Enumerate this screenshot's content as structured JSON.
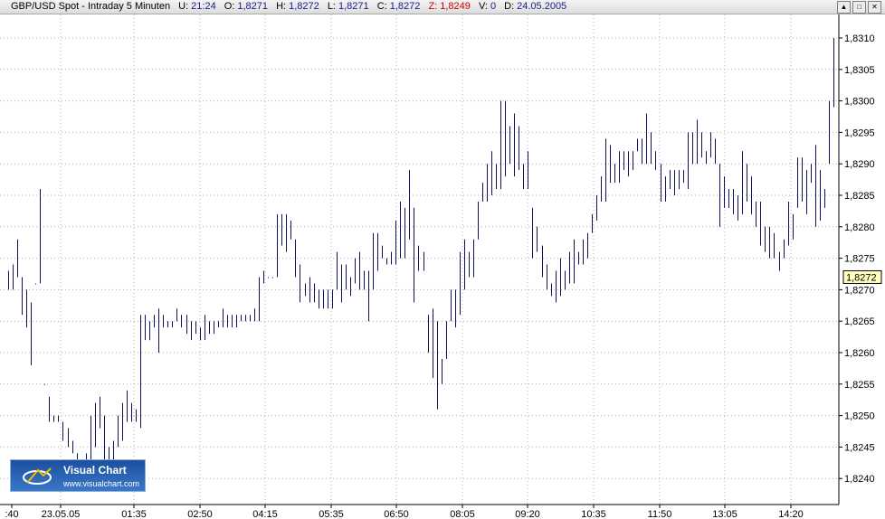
{
  "header": {
    "symbol": "GBP/USD Spot - Intraday 5 Minuten",
    "u_label": "U:",
    "u_value": "21:24",
    "o_label": "O:",
    "o_value": "1,8271",
    "h_label": "H:",
    "h_value": "1,8272",
    "l_label": "L:",
    "l_value": "1,8271",
    "c_label": "C:",
    "c_value": "1,8272",
    "z_label": "Z:",
    "z_value": "1,8249",
    "v_label": "V:",
    "v_value": "0",
    "d_label": "D:",
    "d_value": "24.05.2005"
  },
  "window_buttons": [
    "▲",
    "□",
    "✕"
  ],
  "logo": {
    "name": "Visual Chart",
    "url": "www.visualchart.com"
  },
  "colors": {
    "bars": "#101058",
    "grid": "#b0b0b0",
    "current_marker": "#ffffc0",
    "z_value": "#d00000"
  },
  "chart_data": {
    "type": "ohlc",
    "title": "GBP/USD Spot - Intraday 5 Minuten",
    "ylim": [
      1.82375,
      1.83125
    ],
    "yticks": [
      "1,8240",
      "1,8245",
      "1,8250",
      "1,8255",
      "1,8260",
      "1,8265",
      "1,8270",
      "1,8275",
      "1,8280",
      "1,8285",
      "1,8290",
      "1,8295",
      "1,8300",
      "1,8305",
      "1,8310"
    ],
    "xticks": [
      ":40",
      "23.05.05",
      "01:35",
      "02:50",
      "04:15",
      "05:35",
      "06:50",
      "08:05",
      "09:20",
      "10:35",
      "11:50",
      "13:05",
      "14:20"
    ],
    "current_value": "1,8272",
    "grid": true,
    "high_low": [
      [
        1.8273,
        1.827
      ],
      [
        1.8274,
        1.827
      ],
      [
        1.8278,
        1.8272
      ],
      [
        1.8272,
        1.8266
      ],
      [
        1.827,
        1.8264
      ],
      [
        1.8268,
        1.8258
      ],
      [
        1.8271,
        1.8271
      ],
      [
        1.8286,
        1.8271
      ],
      [
        1.8255,
        1.8255
      ],
      [
        1.8253,
        1.8249
      ],
      [
        1.825,
        1.8249
      ],
      [
        1.825,
        1.8249
      ],
      [
        1.8249,
        1.8246
      ],
      [
        1.8248,
        1.8245
      ],
      [
        1.8246,
        1.8244
      ],
      [
        1.8244,
        1.8243
      ],
      [
        1.8243,
        1.824
      ],
      [
        1.8244,
        1.8243
      ],
      [
        1.825,
        1.8243
      ],
      [
        1.8252,
        1.8245
      ],
      [
        1.8253,
        1.8248
      ],
      [
        1.825,
        1.8243
      ],
      [
        1.8245,
        1.8242
      ],
      [
        1.8246,
        1.8243
      ],
      [
        1.825,
        1.8245
      ],
      [
        1.8252,
        1.8246
      ],
      [
        1.8254,
        1.8249
      ],
      [
        1.8252,
        1.8249
      ],
      [
        1.8251,
        1.8249
      ],
      [
        1.8266,
        1.8248
      ],
      [
        1.8266,
        1.8262
      ],
      [
        1.8265,
        1.8262
      ],
      [
        1.8266,
        1.8264
      ],
      [
        1.8267,
        1.826
      ],
      [
        1.8266,
        1.8264
      ],
      [
        1.8265,
        1.8264
      ],
      [
        1.8265,
        1.8264
      ],
      [
        1.8267,
        1.8265
      ],
      [
        1.8266,
        1.8264
      ],
      [
        1.8266,
        1.8263
      ],
      [
        1.8265,
        1.8262
      ],
      [
        1.8265,
        1.8263
      ],
      [
        1.8264,
        1.8262
      ],
      [
        1.8266,
        1.8262
      ],
      [
        1.8265,
        1.8263
      ],
      [
        1.8265,
        1.8263
      ],
      [
        1.8265,
        1.8264
      ],
      [
        1.8267,
        1.8264
      ],
      [
        1.8266,
        1.8264
      ],
      [
        1.8266,
        1.8264
      ],
      [
        1.8266,
        1.8264
      ],
      [
        1.8266,
        1.8265
      ],
      [
        1.8266,
        1.8265
      ],
      [
        1.8266,
        1.8265
      ],
      [
        1.8267,
        1.8265
      ],
      [
        1.8272,
        1.8265
      ],
      [
        1.8273,
        1.8271
      ],
      [
        1.8272,
        1.8272
      ],
      [
        1.8272,
        1.8272
      ],
      [
        1.8282,
        1.8272
      ],
      [
        1.8282,
        1.8277
      ],
      [
        1.8282,
        1.8276
      ],
      [
        1.8281,
        1.8278
      ],
      [
        1.8278,
        1.8272
      ],
      [
        1.8274,
        1.8268
      ],
      [
        1.8271,
        1.8269
      ],
      [
        1.8272,
        1.8268
      ],
      [
        1.8271,
        1.8268
      ],
      [
        1.827,
        1.8267
      ],
      [
        1.827,
        1.8267
      ],
      [
        1.827,
        1.8267
      ],
      [
        1.827,
        1.8267
      ],
      [
        1.8276,
        1.827
      ],
      [
        1.8274,
        1.8268
      ],
      [
        1.8274,
        1.827
      ],
      [
        1.8272,
        1.8269
      ],
      [
        1.8275,
        1.8271
      ],
      [
        1.8276,
        1.827
      ],
      [
        1.8273,
        1.827
      ],
      [
        1.8273,
        1.8265
      ],
      [
        1.8279,
        1.827
      ],
      [
        1.8279,
        1.8273
      ],
      [
        1.8277,
        1.8275
      ],
      [
        1.8275,
        1.8274
      ],
      [
        1.8276,
        1.8274
      ],
      [
        1.8281,
        1.8274
      ],
      [
        1.8284,
        1.8275
      ],
      [
        1.8283,
        1.8275
      ],
      [
        1.8289,
        1.8278
      ],
      [
        1.8283,
        1.8268
      ],
      [
        1.8277,
        1.8273
      ],
      [
        1.8276,
        1.8273
      ],
      [
        1.8266,
        1.826
      ],
      [
        1.8267,
        1.8256
      ],
      [
        1.8265,
        1.8251
      ],
      [
        1.8259,
        1.8255
      ],
      [
        1.8265,
        1.8259
      ],
      [
        1.827,
        1.8265
      ],
      [
        1.827,
        1.8264
      ],
      [
        1.8276,
        1.8266
      ],
      [
        1.8278,
        1.827
      ],
      [
        1.8276,
        1.8272
      ],
      [
        1.8278,
        1.8272
      ],
      [
        1.8284,
        1.8278
      ],
      [
        1.8287,
        1.8284
      ],
      [
        1.829,
        1.8284
      ],
      [
        1.8292,
        1.8285
      ],
      [
        1.829,
        1.8286
      ],
      [
        1.83,
        1.8286
      ],
      [
        1.83,
        1.8288
      ],
      [
        1.8296,
        1.829
      ],
      [
        1.8298,
        1.8288
      ],
      [
        1.8296,
        1.8289
      ],
      [
        1.829,
        1.8286
      ],
      [
        1.8292,
        1.8286
      ],
      [
        1.8283,
        1.8275
      ],
      [
        1.828,
        1.8276
      ],
      [
        1.8277,
        1.8272
      ],
      [
        1.8274,
        1.827
      ],
      [
        1.8271,
        1.8269
      ],
      [
        1.8273,
        1.8268
      ],
      [
        1.8275,
        1.8269
      ],
      [
        1.8273,
        1.827
      ],
      [
        1.8276,
        1.8271
      ],
      [
        1.8278,
        1.8271
      ],
      [
        1.8276,
        1.8274
      ],
      [
        1.8278,
        1.8274
      ],
      [
        1.8279,
        1.8275
      ],
      [
        1.8282,
        1.8279
      ],
      [
        1.8285,
        1.8281
      ],
      [
        1.8288,
        1.8284
      ],
      [
        1.8294,
        1.8284
      ],
      [
        1.8293,
        1.8287
      ],
      [
        1.829,
        1.8287
      ],
      [
        1.8292,
        1.8287
      ],
      [
        1.8292,
        1.8289
      ],
      [
        1.8292,
        1.8288
      ],
      [
        1.8292,
        1.8289
      ],
      [
        1.8294,
        1.8292
      ],
      [
        1.8294,
        1.829
      ],
      [
        1.8298,
        1.829
      ],
      [
        1.8295,
        1.829
      ],
      [
        1.8292,
        1.8289
      ],
      [
        1.829,
        1.8284
      ],
      [
        1.8288,
        1.8284
      ],
      [
        1.8289,
        1.8286
      ],
      [
        1.8289,
        1.8285
      ],
      [
        1.8289,
        1.8286
      ],
      [
        1.8289,
        1.8287
      ],
      [
        1.8295,
        1.8286
      ],
      [
        1.8295,
        1.829
      ],
      [
        1.8297,
        1.829
      ],
      [
        1.8295,
        1.8291
      ],
      [
        1.8292,
        1.829
      ],
      [
        1.8295,
        1.8291
      ],
      [
        1.8294,
        1.829
      ],
      [
        1.829,
        1.828
      ],
      [
        1.8288,
        1.8283
      ],
      [
        1.8286,
        1.8283
      ],
      [
        1.8286,
        1.8282
      ],
      [
        1.8285,
        1.8281
      ],
      [
        1.8292,
        1.8282
      ],
      [
        1.829,
        1.8284
      ],
      [
        1.8288,
        1.8282
      ],
      [
        1.8284,
        1.828
      ],
      [
        1.8284,
        1.8277
      ],
      [
        1.828,
        1.8276
      ],
      [
        1.828,
        1.8275
      ],
      [
        1.8279,
        1.8275
      ],
      [
        1.8276,
        1.8273
      ],
      [
        1.8278,
        1.8275
      ],
      [
        1.8284,
        1.8277
      ],
      [
        1.8282,
        1.8278
      ],
      [
        1.8291,
        1.8283
      ],
      [
        1.8291,
        1.8284
      ],
      [
        1.8289,
        1.8282
      ],
      [
        1.829,
        1.8287
      ],
      [
        1.8293,
        1.828
      ],
      [
        1.8289,
        1.8281
      ],
      [
        1.8286,
        1.8283
      ],
      [
        1.83,
        1.829
      ],
      [
        1.831,
        1.8299
      ]
    ]
  }
}
